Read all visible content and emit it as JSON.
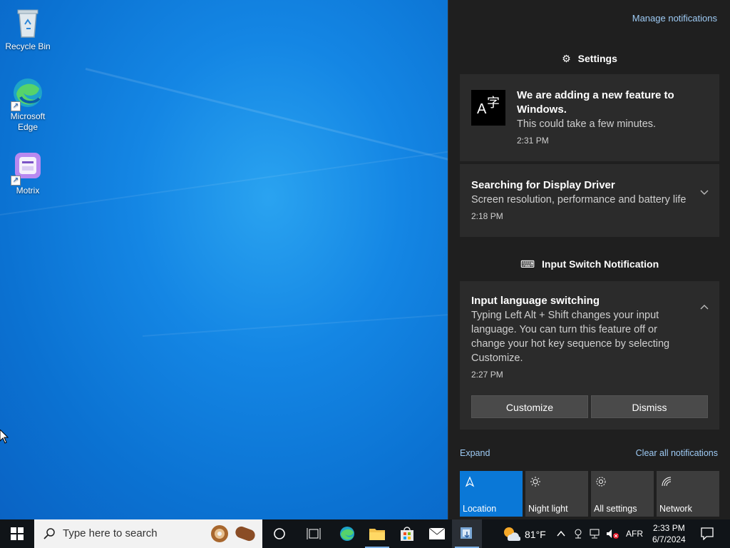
{
  "desktop": {
    "icons": [
      {
        "label": "Recycle Bin",
        "icon": "recycle-bin-icon"
      },
      {
        "label": "Microsoft Edge",
        "icon": "edge-icon"
      },
      {
        "label": "Motrix",
        "icon": "motrix-icon"
      }
    ]
  },
  "action_center": {
    "manage_label": "Manage notifications",
    "settings_group": {
      "title": "Settings",
      "icon": "gear-icon"
    },
    "feature_card": {
      "title": "We are adding a new feature to Windows.",
      "body": "This could take a few minutes.",
      "time": "2:31 PM",
      "icon": "language-icon"
    },
    "driver_card": {
      "title": "Searching for Display Driver",
      "body": "Screen resolution, performance and battery life",
      "time": "2:18 PM"
    },
    "input_group": {
      "title": "Input Switch Notification",
      "icon": "keyboard-icon"
    },
    "input_card": {
      "title": "Input language switching",
      "body": "Typing Left Alt + Shift changes your input language. You can turn this feature off or change your hot key sequence by selecting Customize.",
      "time": "2:27 PM",
      "customize_label": "Customize",
      "dismiss_label": "Dismiss"
    },
    "expand_label": "Expand",
    "clear_label": "Clear all notifications",
    "quick_actions": [
      {
        "label": "Location",
        "icon": "location-icon",
        "active": true
      },
      {
        "label": "Night light",
        "icon": "brightness-icon",
        "active": false
      },
      {
        "label": "All settings",
        "icon": "gear-icon",
        "active": false
      },
      {
        "label": "Network",
        "icon": "network-icon",
        "active": false
      }
    ]
  },
  "taskbar": {
    "search_placeholder": "Type here to search",
    "weather": "81°F",
    "language": "AFR",
    "time": "2:33 PM",
    "date": "6/7/2024",
    "accent_color": "#0a78d7"
  }
}
